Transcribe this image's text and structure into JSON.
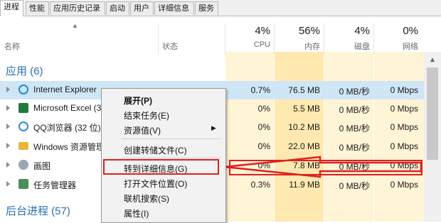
{
  "tabs": [
    "进程",
    "性能",
    "应用历史记录",
    "启动",
    "用户",
    "详细信息",
    "服务"
  ],
  "columns": {
    "name": "名称",
    "status": "状态",
    "cpu": {
      "pct": "4%",
      "label": "CPU"
    },
    "memory": {
      "pct": "56%",
      "label": "内存"
    },
    "disk": {
      "pct": "4%",
      "label": "磁盘"
    },
    "network": {
      "pct": "0%",
      "label": "网络"
    }
  },
  "groups": {
    "apps": "应用 (6)",
    "background": "后台进程 (57)"
  },
  "rows": [
    {
      "name": "Internet Explorer",
      "cpu": "0.7%",
      "memory": "76.5 MB",
      "disk": "0 MB/秒",
      "network": "0 Mbps"
    },
    {
      "name": "Microsoft Excel (3",
      "cpu": "0%",
      "memory": "5.5 MB",
      "disk": "0 MB/秒",
      "network": "0 Mbps"
    },
    {
      "name": "QQ浏览器 (32 位)",
      "cpu": "0%",
      "memory": "10.2 MB",
      "disk": "0 MB/秒",
      "network": "0 Mbps"
    },
    {
      "name": "Windows 资源管理",
      "cpu": "0%",
      "memory": "22.0 MB",
      "disk": "0 MB/秒",
      "network": "0 Mbps"
    },
    {
      "name": "画图",
      "cpu": "0%",
      "memory": "7.8 MB",
      "disk": "0 MB/秒",
      "network": "0 Mbps"
    },
    {
      "name": "任务管理器",
      "cpu": "0.3%",
      "memory": "11.9 MB",
      "disk": "0 MB/秒",
      "network": "0 Mbps"
    }
  ],
  "context_menu": {
    "expand": "展开(P)",
    "end_task": "结束任务(E)",
    "resource_values": "资源值(V)",
    "create_dump": "创建转储文件(C)",
    "go_to_details": "转到详细信息(G)",
    "open_file_location": "打开文件位置(O)",
    "search_online": "联机搜索(S)",
    "properties": "属性(I)"
  },
  "icons": [
    "ie-icon",
    "excel-icon",
    "qq-browser-icon",
    "explorer-icon",
    "paint-icon",
    "task-manager-icon"
  ],
  "colors": {
    "accent": "#2a6fb0",
    "highlight_red": "#e02020",
    "selected_row": "#cfe6f7",
    "column_shade": "#fff4d6"
  }
}
